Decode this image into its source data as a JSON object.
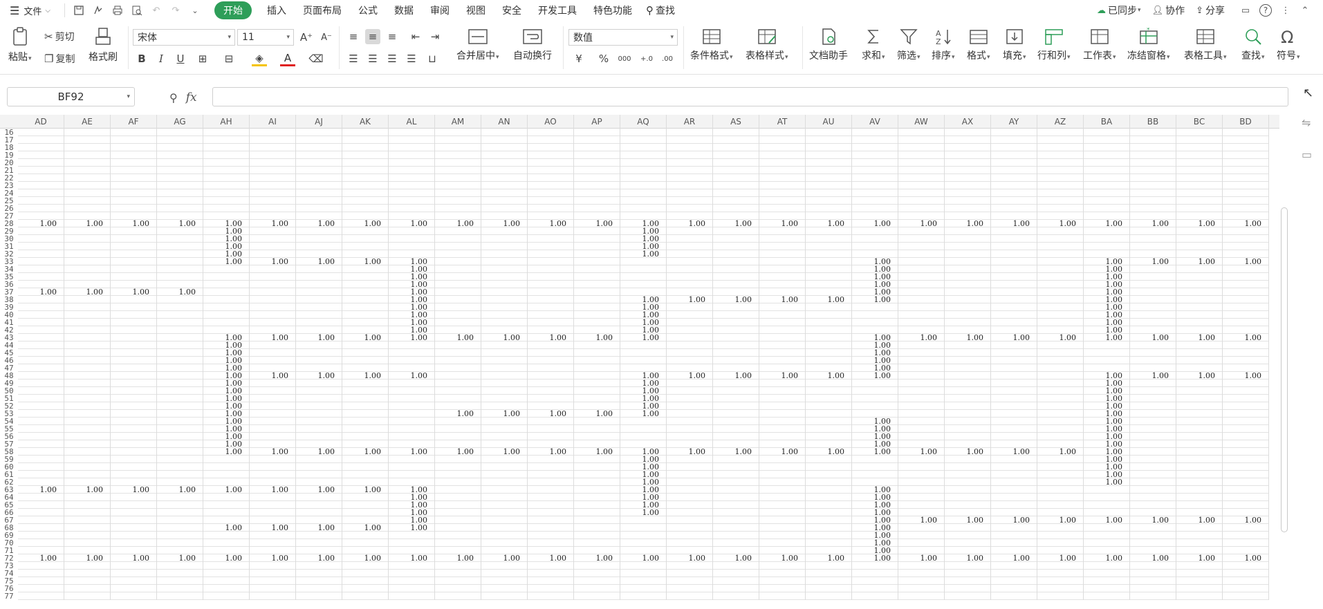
{
  "menubar": {
    "file_label": "文件",
    "tabs": [
      "开始",
      "插入",
      "页面布局",
      "公式",
      "数据",
      "审阅",
      "视图",
      "安全",
      "开发工具",
      "特色功能"
    ],
    "search_label": "查找",
    "sync_label": "已同步",
    "collab_label": "协作",
    "share_label": "分享"
  },
  "ribbon": {
    "paste": "粘贴",
    "cut": "剪切",
    "copy": "复制",
    "format_painter": "格式刷",
    "font_name": "宋体",
    "font_size": "11",
    "merge_center": "合并居中",
    "wrap_text": "自动换行",
    "number_format": "数值",
    "cond_format": "条件格式",
    "table_style": "表格样式",
    "doc_helper": "文档助手",
    "sum": "求和",
    "filter": "筛选",
    "sort": "排序",
    "format": "格式",
    "fill": "填充",
    "row_col": "行和列",
    "worksheet": "工作表",
    "freeze": "冻结窗格",
    "table_tools": "表格工具",
    "find": "查找",
    "symbol": "符号"
  },
  "formula": {
    "name_box": "BF92",
    "fx_label": "fx",
    "content": ""
  },
  "sheet": {
    "columns": [
      "AD",
      "AE",
      "AF",
      "AG",
      "AH",
      "AI",
      "AJ",
      "AK",
      "AL",
      "AM",
      "AN",
      "AO",
      "AP",
      "AQ",
      "AR",
      "AS",
      "AT",
      "AU",
      "AV",
      "AW",
      "AX",
      "AY",
      "AZ",
      "BA",
      "BB",
      "BC",
      "BD"
    ],
    "first_row": 16,
    "last_row": 77,
    "cell_value": "1.00",
    "cells": {
      "28": [
        "AD",
        "AE",
        "AF",
        "AG",
        "AH",
        "AI",
        "AJ",
        "AK",
        "AL",
        "AM",
        "AN",
        "AO",
        "AP",
        "AQ",
        "AR",
        "AS",
        "AT",
        "AU",
        "AV",
        "AW",
        "AX",
        "AY",
        "AZ",
        "BA",
        "BB",
        "BC",
        "BD"
      ],
      "29": [
        "AH",
        "AQ"
      ],
      "30": [
        "AH",
        "AQ"
      ],
      "31": [
        "AH",
        "AQ"
      ],
      "32": [
        "AH",
        "AQ"
      ],
      "33": [
        "AH",
        "AI",
        "AJ",
        "AK",
        "AL",
        "AV",
        "BA",
        "BB",
        "BC",
        "BD"
      ],
      "34": [
        "AL",
        "AV",
        "BA"
      ],
      "35": [
        "AL",
        "AV",
        "BA"
      ],
      "36": [
        "AL",
        "AV",
        "BA"
      ],
      "37": [
        "AD",
        "AE",
        "AF",
        "AG",
        "AL",
        "AV",
        "BA"
      ],
      "38": [
        "AL",
        "AQ",
        "AR",
        "AS",
        "AT",
        "AU",
        "AV",
        "BA"
      ],
      "39": [
        "AL",
        "AQ",
        "BA"
      ],
      "40": [
        "AL",
        "AQ",
        "BA"
      ],
      "41": [
        "AL",
        "AQ",
        "BA"
      ],
      "42": [
        "AL",
        "AQ",
        "BA"
      ],
      "43": [
        "AH",
        "AI",
        "AJ",
        "AK",
        "AL",
        "AM",
        "AN",
        "AO",
        "AP",
        "AQ",
        "AV",
        "AW",
        "AX",
        "AY",
        "AZ",
        "BA",
        "BB",
        "BC",
        "BD"
      ],
      "44": [
        "AH",
        "AV"
      ],
      "45": [
        "AH",
        "AV"
      ],
      "46": [
        "AH",
        "AV"
      ],
      "47": [
        "AH",
        "AV"
      ],
      "48": [
        "AH",
        "AI",
        "AJ",
        "AK",
        "AL",
        "AQ",
        "AR",
        "AS",
        "AT",
        "AU",
        "AV",
        "BA",
        "BB",
        "BC",
        "BD"
      ],
      "49": [
        "AH",
        "AQ",
        "BA"
      ],
      "50": [
        "AH",
        "AQ",
        "BA"
      ],
      "51": [
        "AH",
        "AQ",
        "BA"
      ],
      "52": [
        "AH",
        "AQ",
        "BA"
      ],
      "53": [
        "AH",
        "AM",
        "AN",
        "AO",
        "AP",
        "AQ",
        "BA"
      ],
      "54": [
        "AH",
        "AV",
        "BA"
      ],
      "55": [
        "AH",
        "AV",
        "BA"
      ],
      "56": [
        "AH",
        "AV",
        "BA"
      ],
      "57": [
        "AH",
        "AV",
        "BA"
      ],
      "58": [
        "AH",
        "AI",
        "AJ",
        "AK",
        "AL",
        "AM",
        "AN",
        "AO",
        "AP",
        "AQ",
        "AR",
        "AS",
        "AT",
        "AU",
        "AV",
        "AW",
        "AX",
        "AY",
        "AZ",
        "BA"
      ],
      "59": [
        "AQ",
        "BA"
      ],
      "60": [
        "AQ",
        "BA"
      ],
      "61": [
        "AQ",
        "BA"
      ],
      "62": [
        "AQ",
        "BA"
      ],
      "63": [
        "AD",
        "AE",
        "AF",
        "AG",
        "AH",
        "AI",
        "AJ",
        "AK",
        "AL",
        "AQ",
        "AV"
      ],
      "64": [
        "AL",
        "AQ",
        "AV"
      ],
      "65": [
        "AL",
        "AQ",
        "AV"
      ],
      "66": [
        "AL",
        "AQ",
        "AV"
      ],
      "67": [
        "AL",
        "AV",
        "AW",
        "AX",
        "AY",
        "AZ",
        "BA",
        "BB",
        "BC",
        "BD"
      ],
      "68": [
        "AH",
        "AI",
        "AJ",
        "AK",
        "AL",
        "AV"
      ],
      "69": [
        "AV"
      ],
      "70": [
        "AV"
      ],
      "71": [
        "AV"
      ],
      "72": [
        "AD",
        "AE",
        "AF",
        "AG",
        "AH",
        "AI",
        "AJ",
        "AK",
        "AL",
        "AM",
        "AN",
        "AO",
        "AP",
        "AQ",
        "AR",
        "AS",
        "AT",
        "AU",
        "AV",
        "AW",
        "AX",
        "AY",
        "AZ",
        "BA",
        "BB",
        "BC",
        "BD"
      ]
    }
  }
}
